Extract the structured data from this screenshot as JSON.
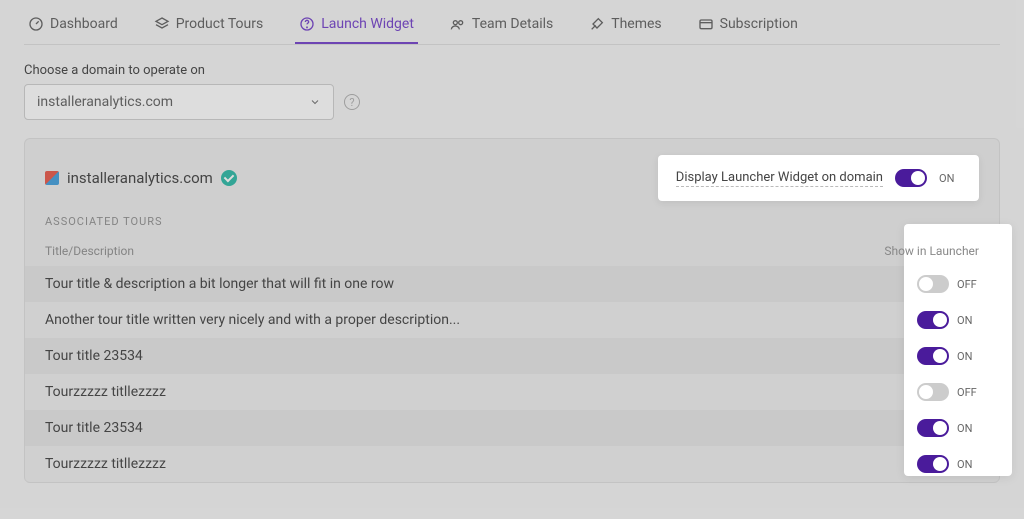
{
  "tabs": [
    {
      "label": "Dashboard"
    },
    {
      "label": "Product Tours"
    },
    {
      "label": "Launch Widget"
    },
    {
      "label": "Team Details"
    },
    {
      "label": "Themes"
    },
    {
      "label": "Subscription"
    }
  ],
  "active_tab_index": 2,
  "domain_picker": {
    "label": "Choose a domain to operate on",
    "selected": "installeranalytics.com"
  },
  "card": {
    "domain": "installeranalytics.com",
    "verified": true,
    "launcher_toggle": {
      "label": "Display Launcher Widget on domain",
      "on": true,
      "on_text": "ON",
      "off_text": "OFF"
    },
    "section_label": "ASSOCIATED TOURS",
    "columns": {
      "title": "Title/Description",
      "show": "Show in Launcher"
    },
    "rows": [
      {
        "title": "Tour title & description a bit longer that will fit in one row",
        "on": false
      },
      {
        "title": "Another tour title written very nicely and with a proper description...",
        "on": true
      },
      {
        "title": "Tour title 23534",
        "on": true
      },
      {
        "title": "Tourzzzzz titllezzzz",
        "on": false
      },
      {
        "title": "Tour title 23534",
        "on": true
      },
      {
        "title": "Tourzzzzz titllezzzz",
        "on": true
      }
    ],
    "on_text": "ON",
    "off_text": "OFF"
  }
}
